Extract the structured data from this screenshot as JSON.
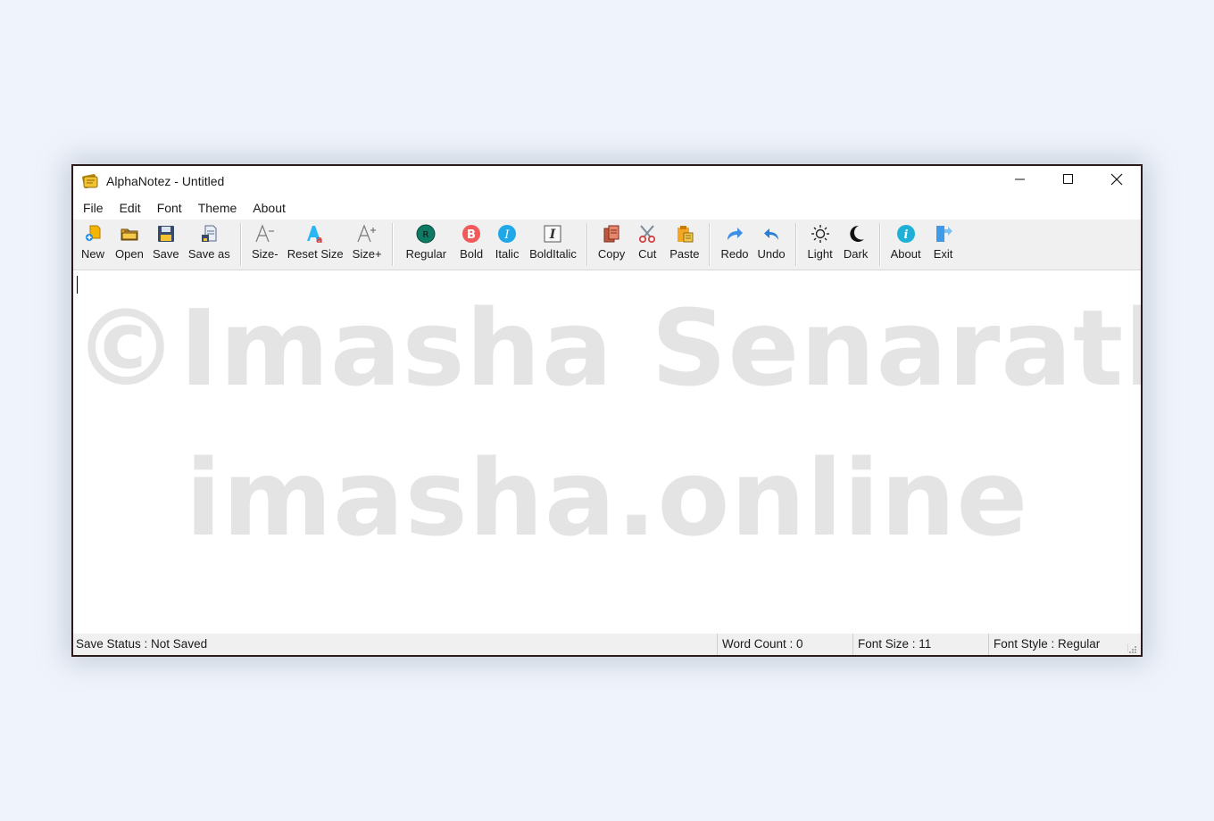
{
  "window": {
    "title": "AlphaNotez - Untitled",
    "app_icon": "notepad-icon",
    "controls": {
      "minimize": "minimize-icon",
      "maximize": "maximize-icon",
      "close": "close-icon"
    }
  },
  "menubar": {
    "items": [
      {
        "label": "File"
      },
      {
        "label": "Edit"
      },
      {
        "label": "Font"
      },
      {
        "label": "Theme"
      },
      {
        "label": "About"
      }
    ]
  },
  "toolbar": {
    "groups": [
      [
        {
          "label": "New",
          "icon": "new-file-icon"
        },
        {
          "label": "Open",
          "icon": "folder-open-icon"
        },
        {
          "label": "Save",
          "icon": "floppy-disk-icon"
        },
        {
          "label": "Save as",
          "icon": "save-as-icon"
        }
      ],
      [
        {
          "label": "Size-",
          "icon": "font-size-decrease-icon"
        },
        {
          "label": "Reset Size",
          "icon": "font-size-reset-icon"
        },
        {
          "label": "Size+",
          "icon": "font-size-increase-icon"
        }
      ],
      [
        {
          "label": "Regular",
          "icon": "regular-style-icon"
        },
        {
          "label": "Bold",
          "icon": "bold-style-icon"
        },
        {
          "label": "Italic",
          "icon": "italic-style-icon"
        },
        {
          "label": "BoldItalic",
          "icon": "bold-italic-style-icon"
        }
      ],
      [
        {
          "label": "Copy",
          "icon": "copy-icon"
        },
        {
          "label": "Cut",
          "icon": "scissors-icon"
        },
        {
          "label": "Paste",
          "icon": "paste-icon"
        }
      ],
      [
        {
          "label": "Redo",
          "icon": "redo-arrow-icon"
        },
        {
          "label": "Undo",
          "icon": "undo-arrow-icon"
        }
      ],
      [
        {
          "label": "Light",
          "icon": "sun-icon"
        },
        {
          "label": "Dark",
          "icon": "moon-icon"
        }
      ],
      [
        {
          "label": "About",
          "icon": "info-icon"
        },
        {
          "label": "Exit",
          "icon": "exit-door-icon"
        }
      ]
    ]
  },
  "editor": {
    "content": "",
    "watermark_line1": "©Imasha Senarath",
    "watermark_line2": "imasha.online"
  },
  "statusbar": {
    "save_status": "Save Status : Not Saved",
    "word_count": "Word Count : 0",
    "font_size": "Font Size : 11",
    "font_style": "Font Style : Regular"
  }
}
